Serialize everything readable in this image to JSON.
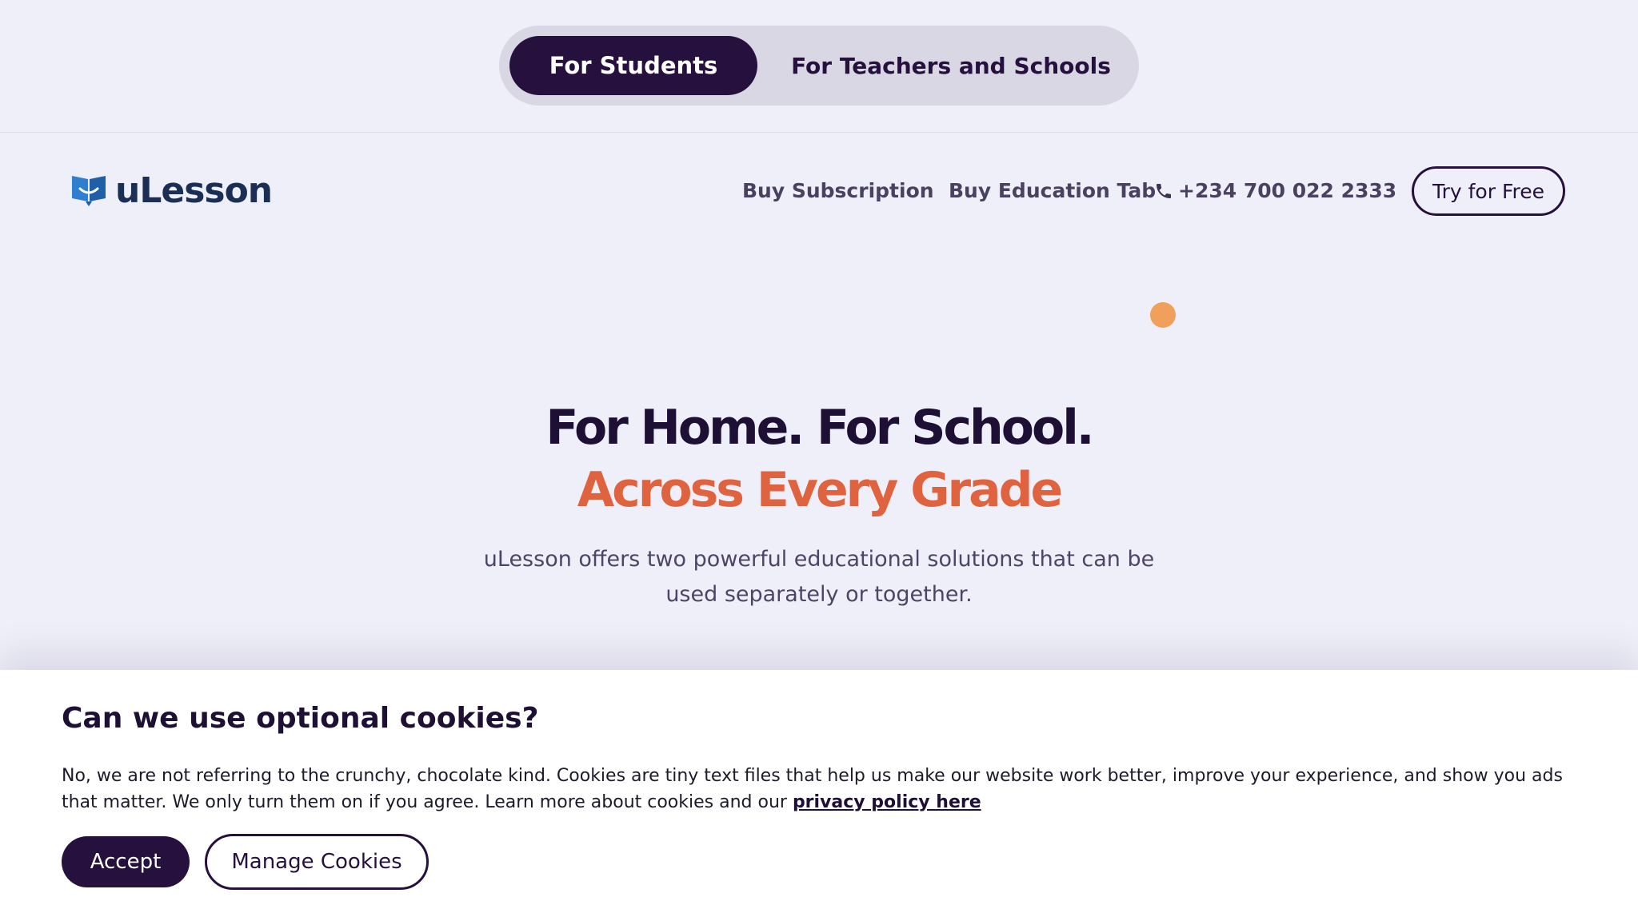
{
  "audience_switch": {
    "active_label": "For Students",
    "inactive_label": "For Teachers and Schools"
  },
  "nav": {
    "logo_text": "uLesson",
    "links": [
      "Buy Subscription",
      "Buy Education Tab"
    ],
    "phone_icon": "phone-icon",
    "phone": "+234 700 022 2333",
    "cta": "Try for Free"
  },
  "hero": {
    "title_line1": "For Home. For School.",
    "title_line2": "Across Every Grade",
    "subtitle": "uLesson offers two powerful educational solutions that can be used separately or together."
  },
  "cookie_banner": {
    "title": "Can we use optional cookies?",
    "body": "No, we are not referring to the crunchy, chocolate kind. Cookies are tiny text files that help us make our website work better, improve your experience, and show you ads that matter. We only turn them on if you agree. Learn more about cookies and our ",
    "link_text": "privacy policy here",
    "accept": "Accept",
    "manage": "Manage Cookies"
  },
  "colors": {
    "brand_dark": "#26103d",
    "accent_orange": "#e0633f",
    "dot": "#f0a05a",
    "logo_blue": "#2f7fd0"
  }
}
